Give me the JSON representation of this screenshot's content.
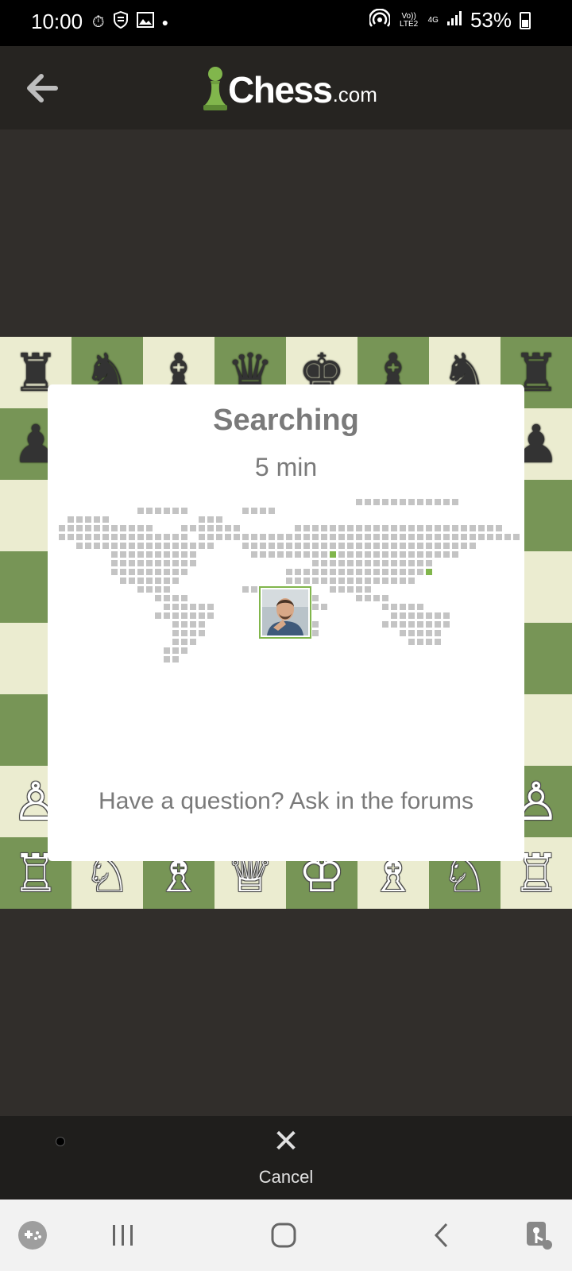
{
  "status_bar": {
    "time": "10:00",
    "network_label": "Vo)) LTE2",
    "network_type": "4G",
    "battery": "53%"
  },
  "header": {
    "brand": "Chess",
    "brand_tld": ".com"
  },
  "modal": {
    "title": "Searching",
    "time_control": "5 min",
    "forum_prompt": "Have a question? Ask in the forums"
  },
  "bottom_bar": {
    "cancel_label": "Cancel"
  },
  "board": {
    "ranks": [
      [
        "♜",
        "♞",
        "♝",
        "♛",
        "♚",
        "♝",
        "♞",
        "♜"
      ],
      [
        "♟",
        "♟",
        "♟",
        "♟",
        "♟",
        "♟",
        "♟",
        "♟"
      ],
      [
        "",
        "",
        "",
        "",
        "",
        "",
        "",
        ""
      ],
      [
        "",
        "",
        "",
        "",
        "",
        "",
        "",
        ""
      ],
      [
        "",
        "",
        "",
        "",
        "",
        "",
        "",
        ""
      ],
      [
        "",
        "",
        "",
        "",
        "",
        "",
        "",
        ""
      ],
      [
        "♙",
        "♙",
        "♙",
        "♙",
        "♙",
        "♙",
        "♙",
        "♙"
      ],
      [
        "♖",
        "♘",
        "♗",
        "♕",
        "♔",
        "♗",
        "♘",
        "♖"
      ]
    ]
  },
  "colors": {
    "board_light": "#ebecd0",
    "board_dark": "#779556",
    "accent_green": "#81b64c",
    "background": "#312e2b"
  }
}
